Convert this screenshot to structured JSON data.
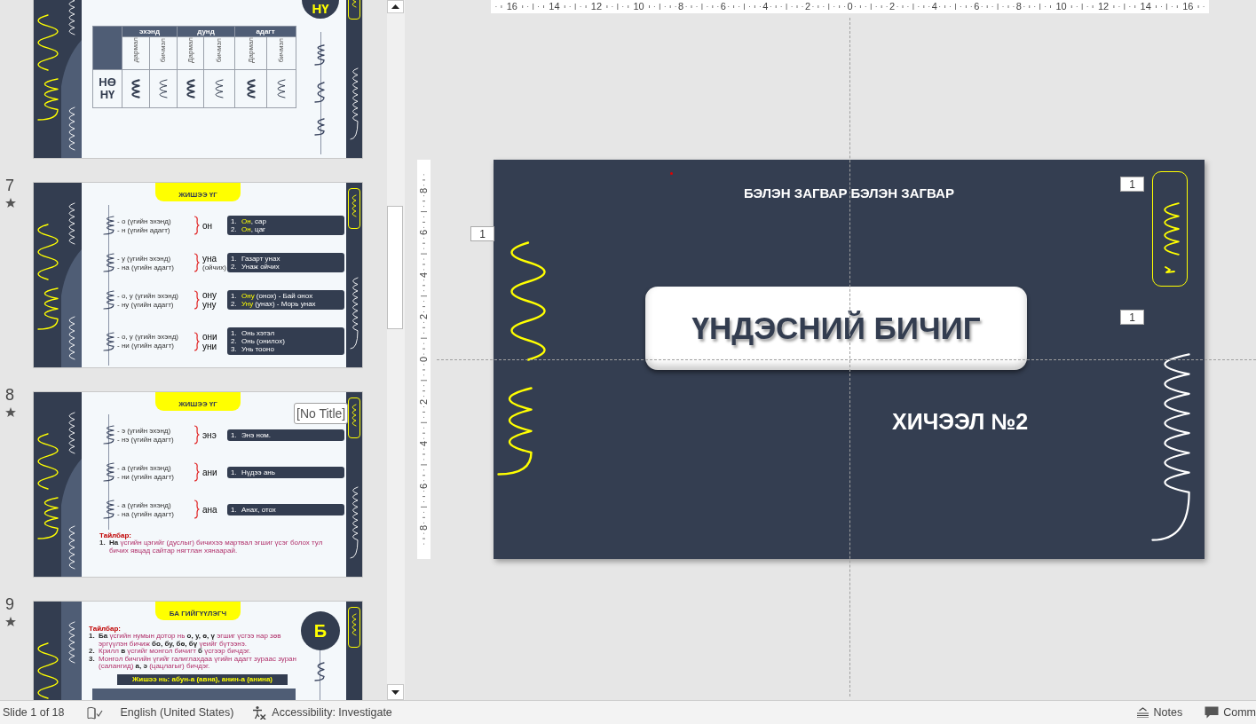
{
  "slide_pane": {
    "slides": [
      {
        "kind": "letter_table",
        "selected": false,
        "badge": "НҮ",
        "table": {
          "groups": [
            "эхэнд",
            "дунд",
            "адагт"
          ],
          "subheads": [
            "дармал",
            "бичмэл",
            "Дармал",
            "бичмэл",
            "Дармал",
            "бичмэл"
          ],
          "row_label": "НӨ НҮ"
        }
      },
      {
        "kind": "examples",
        "number": "7",
        "animated": true,
        "selected": false,
        "title": "ЖИШЭЭ ҮГ",
        "rows": [
          {
            "forms": [
              "- о (үгийн эхэнд)",
              "- н (үгийн адагт)"
            ],
            "words": [
              "он"
            ],
            "examples": [
              {
                "number": "1.",
                "highlight": "Он",
                "text": ", сар"
              },
              {
                "number": "2.",
                "highlight": "Он",
                "text": ", цаг"
              }
            ]
          },
          {
            "forms": [
              "- у (үгийн эхэнд)",
              "- на (үгийн адагт)"
            ],
            "words": [
              "уна"
            ],
            "note": "(ойчих)",
            "examples": [
              {
                "number": "1.",
                "text": "Газарт унах"
              },
              {
                "number": "2.",
                "text": "Унаж ойчих"
              }
            ]
          },
          {
            "forms": [
              "- о, у (үгийн эхэнд)",
              "- ну (үгийн адагт)"
            ],
            "words": [
              "ону",
              "уну"
            ],
            "examples": [
              {
                "number": "1.",
                "highlight": "Ону",
                "text": " (онох) - Бай онох"
              },
              {
                "number": "2.",
                "highlight": "Уну",
                "text": " (унах) - Морь унах"
              }
            ]
          },
          {
            "forms": [
              "- о, у (үгийн эхэнд)",
              "- ни (үгийн адагт)"
            ],
            "words": [
              "они",
              "уни"
            ],
            "examples": [
              {
                "number": "1.",
                "text": "Онь хэтэл"
              },
              {
                "number": "2.",
                "text": "Онь (онилох)"
              },
              {
                "number": "3.",
                "text": "Унь тооно"
              }
            ]
          }
        ]
      },
      {
        "kind": "examples",
        "number": "8",
        "animated": true,
        "selected": false,
        "title": "ЖИШЭЭ ҮГ",
        "rows": [
          {
            "forms": [
              "- э (үгийн эхэнд)",
              "- нэ (үгийн адагт)"
            ],
            "words": [
              "энэ"
            ],
            "examples": [
              {
                "number": "1.",
                "text": "Энэ ном."
              }
            ]
          },
          {
            "forms": [
              "- а (үгийн эхэнд)",
              "- ни (үгийн адагт)"
            ],
            "words": [
              "ани"
            ],
            "examples": [
              {
                "number": "1.",
                "text": "Нүдээ ань"
              }
            ]
          },
          {
            "forms": [
              "- а (үгийн эхэнд)",
              "- на (үгийн адагт)"
            ],
            "words": [
              "ана"
            ],
            "examples": [
              {
                "number": "1.",
                "text": "Анах, отох"
              }
            ]
          }
        ],
        "notes": {
          "heading": "Тайлбар:",
          "items": [
            {
              "number": "1.",
              "text": "**На** үсгийн цэгийг (дуслыг) бичихээ мартвал эгшиг үсэг болох тул бичих явцад сайтар нягтлан хянаарай."
            }
          ]
        }
      },
      {
        "kind": "explanation",
        "number": "9",
        "animated": true,
        "selected": false,
        "title": "БА ГИЙГҮҮЛЭГЧ",
        "badge": "Б",
        "notes": {
          "heading": "Тайлбар:",
          "items": [
            {
              "number": "1.",
              "text": "**Ба** үсгийн нумын дотор нь **о, у, ө, ү** эгшиг үсгээ нар зөв эргүүлэн бичиж **бо, бу, бө, бү** үеийг бүтээнэ."
            },
            {
              "number": "2.",
              "text": "Крилл **в** үсгийг монгол бичигт **б** үсгээр бичдэг."
            },
            {
              "number": "3.",
              "text": "Монгол бичгийн үгийг галиглахдаа үгийн адагт зураас зуран (салангид) **а, э** (цацлагыг) бичдэг."
            }
          ]
        },
        "example": "Жишээ нь: абун-а (авна), анин-а (анина)"
      }
    ],
    "tooltip": "[No Title]"
  },
  "rulers": {
    "horizontal": [
      "16",
      "14",
      "12",
      "10",
      "8",
      "6",
      "4",
      "2",
      "0",
      "2",
      "4",
      "6",
      "8",
      "10",
      "12",
      "14",
      "16"
    ],
    "vertical": [
      "8",
      "6",
      "4",
      "2",
      "0",
      "2",
      "4",
      "6",
      "8"
    ]
  },
  "slide": {
    "header": "БЭЛЭН ЗАГВАР БЭЛЭН ЗАГВАР",
    "title": "ҮНДЭСНИЙ БИЧИГ",
    "subtitle": "ХИЧЭЭЛ №2",
    "animation_tags": [
      "1",
      "1",
      "1"
    ]
  },
  "status_bar": {
    "slide_counter": "Slide 1 of 18",
    "language": "English (United States)",
    "accessibility": "Accessibility: Investigate",
    "notes": "Notes",
    "comments": "Comm"
  }
}
